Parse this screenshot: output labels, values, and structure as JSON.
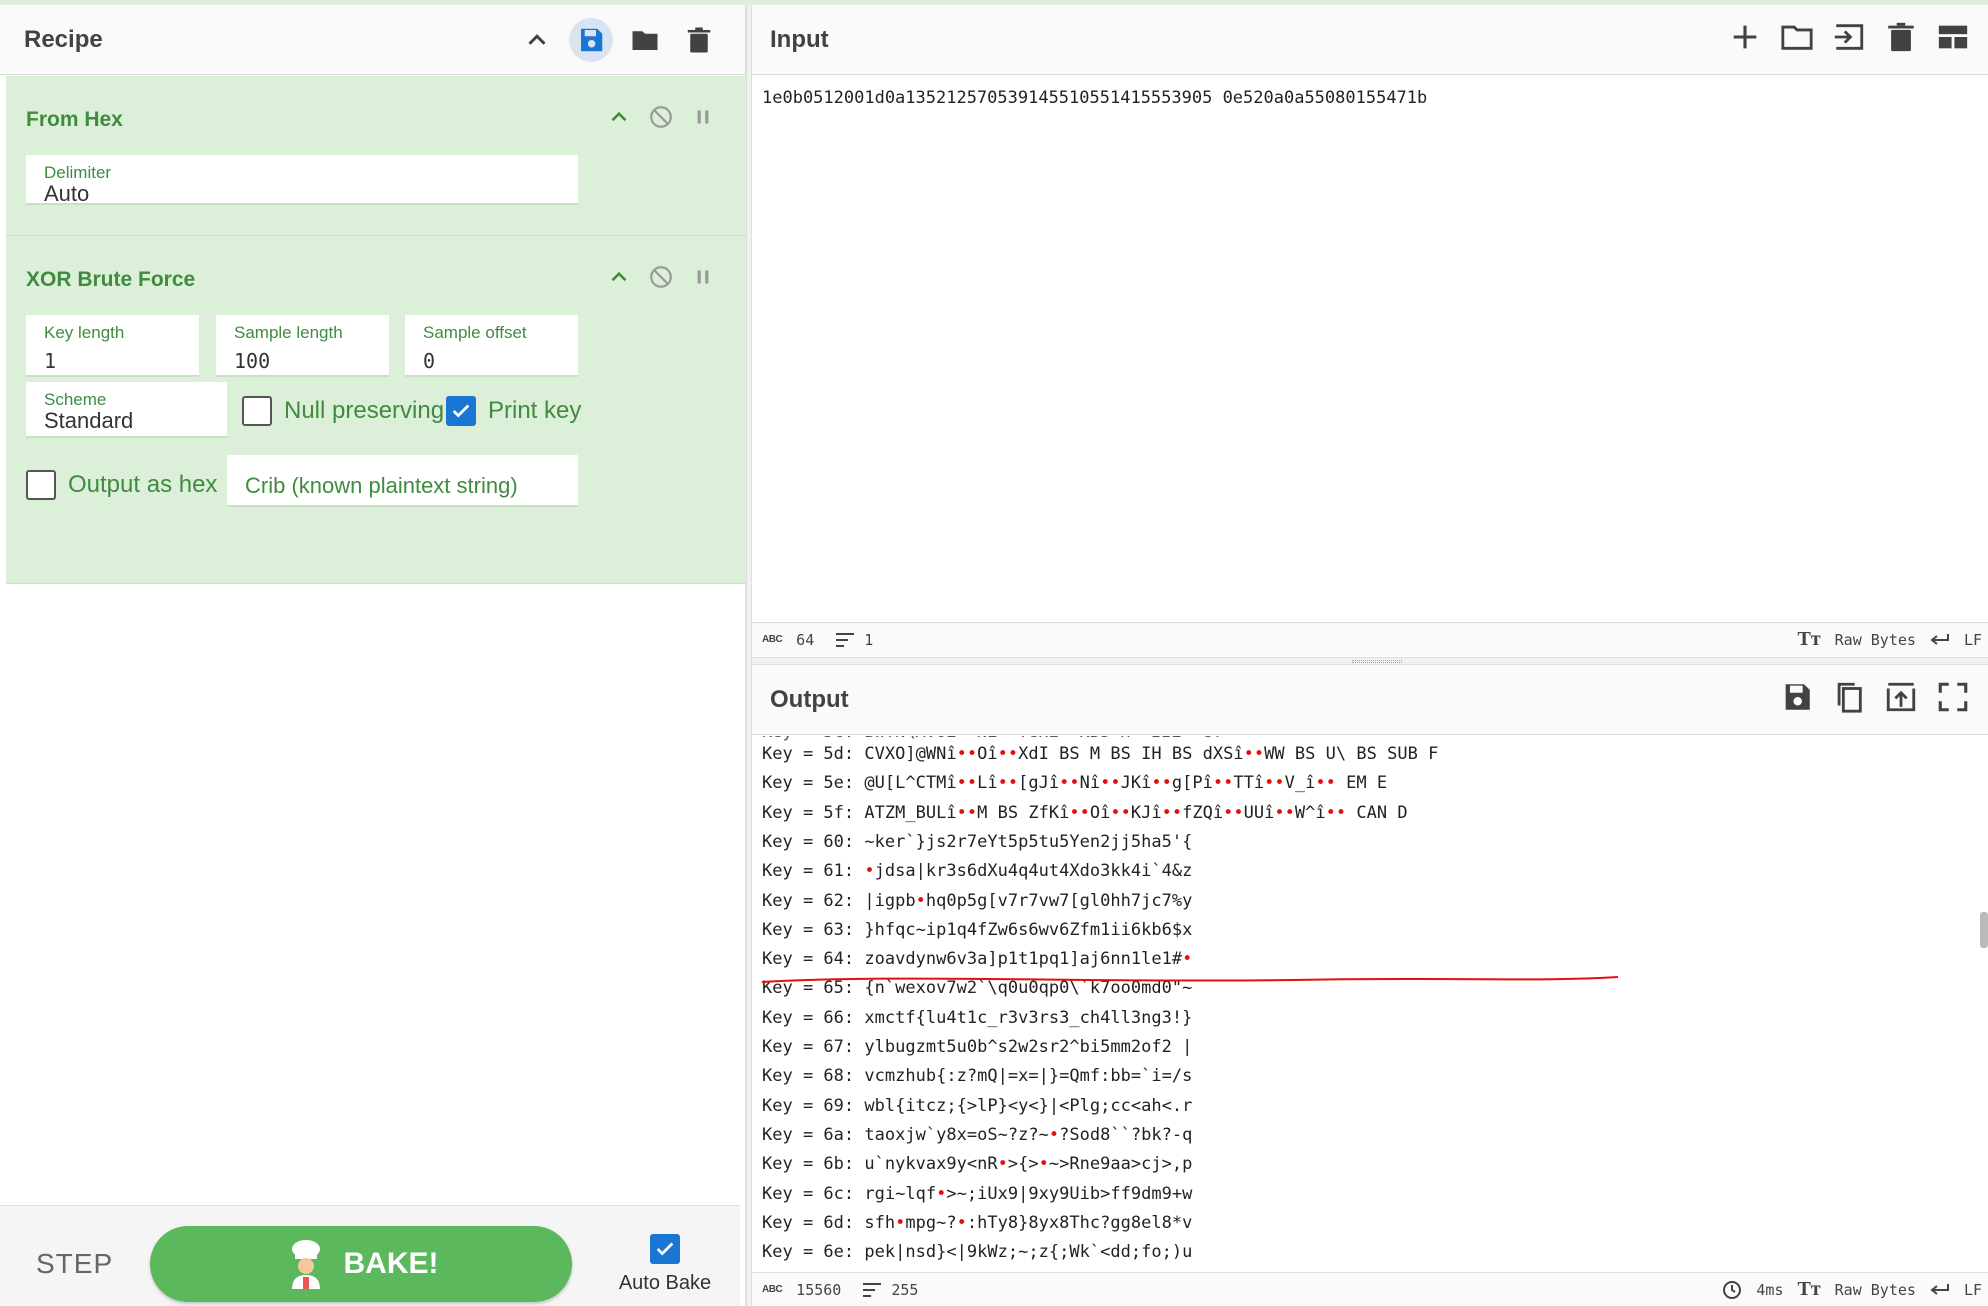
{
  "recipe": {
    "title": "Recipe",
    "icons": [
      "chevron-up-icon",
      "save-icon",
      "folder-icon",
      "trash-icon"
    ],
    "operations": {
      "from_hex": {
        "title": "From Hex",
        "delimiter_label": "Delimiter",
        "delimiter_value": "Auto"
      },
      "xor_brute_force": {
        "title": "XOR Brute Force",
        "key_length_label": "Key length",
        "key_length_value": "1",
        "sample_length_label": "Sample length",
        "sample_length_value": "100",
        "sample_offset_label": "Sample offset",
        "sample_offset_value": "0",
        "scheme_label": "Scheme",
        "scheme_value": "Standard",
        "null_preserving_label": "Null preserving",
        "null_preserving_checked": false,
        "print_key_label": "Print key",
        "print_key_checked": true,
        "output_hex_label": "Output as hex",
        "output_hex_checked": false,
        "crib_placeholder": "Crib (known plaintext string)"
      }
    },
    "controls": {
      "step_label": "STEP",
      "bake_label": "BAKE!",
      "auto_bake_label": "Auto Bake",
      "auto_bake_checked": true
    }
  },
  "input": {
    "title": "Input",
    "value": "1e0b0512001d0a135212570539145510551415553905 0e520a0a55080155471b",
    "status": {
      "length": "64",
      "lines": "1",
      "encoding": "Raw Bytes",
      "eol": "LF"
    }
  },
  "output": {
    "title": "Output",
    "status": {
      "length": "15560",
      "lines": "255",
      "time": "4ms",
      "encoding": "Raw Bytes",
      "eol": "LF"
    },
    "lines": [
      {
        "key": "Key = 5d:",
        "text": "CVXO]@WNî••Oî••XdI BS M BS IH BS dXSî••WW BS U\\ BS SUB F"
      },
      {
        "key": "Key = 5e:",
        "text": "@U[L^CTMî••Lî••[gJî••Nî••JKî••g[Pî••TTî••V_î•• EM E"
      },
      {
        "key": "Key = 5f:",
        "text": "ATZM_BULî••M BS ZfKî••Oî••KJî••fZQî••UUî••W^î•• CAN D"
      },
      {
        "key": "Key = 60:",
        "text": "~ker`}js2r7eYt5p5tu5Yen2jj5ha5'{"
      },
      {
        "key": "Key = 61:",
        "text": "•jdsa|kr3s6dXu4q4ut4Xdo3kk4i`4&z"
      },
      {
        "key": "Key = 62:",
        "text": "|igpb•hq0p5g[v7r7vw7[gl0hh7jc7%y"
      },
      {
        "key": "Key = 63:",
        "text": "}hfqc~ip1q4fZw6s6wv6Zfm1ii6kb6$x"
      },
      {
        "key": "Key = 64:",
        "text": "zoavdynw6v3a]p1t1pq1]aj6nn1le1#•"
      },
      {
        "key": "Key = 65:",
        "text": "{n`wexov7w2`\\q0u0qp0\\`k7oo0md0\"~"
      },
      {
        "key": "Key = 66:",
        "text": "xmctf{lu4t1c_r3v3rs3_ch4ll3ng3!}"
      },
      {
        "key": "Key = 67:",
        "text": "ylbugzmt5u0b^s2w2sr2^bi5mm2of2 |"
      },
      {
        "key": "Key = 68:",
        "text": "vcmzhub{:z?mQ|=x=|}=Qmf:bb=`i=/s"
      },
      {
        "key": "Key = 69:",
        "text": "wbl{itcz;{>lP}<y<}|<Plg;cc<ah<.r"
      },
      {
        "key": "Key = 6a:",
        "text": "taoxjw`y8x=oS~?z?~•?Sod8``?bk?-q"
      },
      {
        "key": "Key = 6b:",
        "text": "u`nykvax9y<nR•>{>•~>Rne9aa>cj>,p"
      },
      {
        "key": "Key = 6c:",
        "text": "rgi~lqf•>~;iUx9|9xy9Uib>ff9dm9+w"
      },
      {
        "key": "Key = 6d:",
        "text": "sfh•mpg~?•:hTy8}8yx8Thc?gg8el8*v"
      },
      {
        "key": "Key = 6e:",
        "text": "pek|nsd}<|9kWz;~;z{;Wk`<dd;fo;)u"
      }
    ]
  },
  "colors": {
    "op_background": "#dcf0d9",
    "op_title": "#3f8b3f",
    "bake_button": "#5cb85c",
    "checkbox_on": "#1976d2",
    "control_char": "#e2100b",
    "annotation": "#e2100b"
  }
}
